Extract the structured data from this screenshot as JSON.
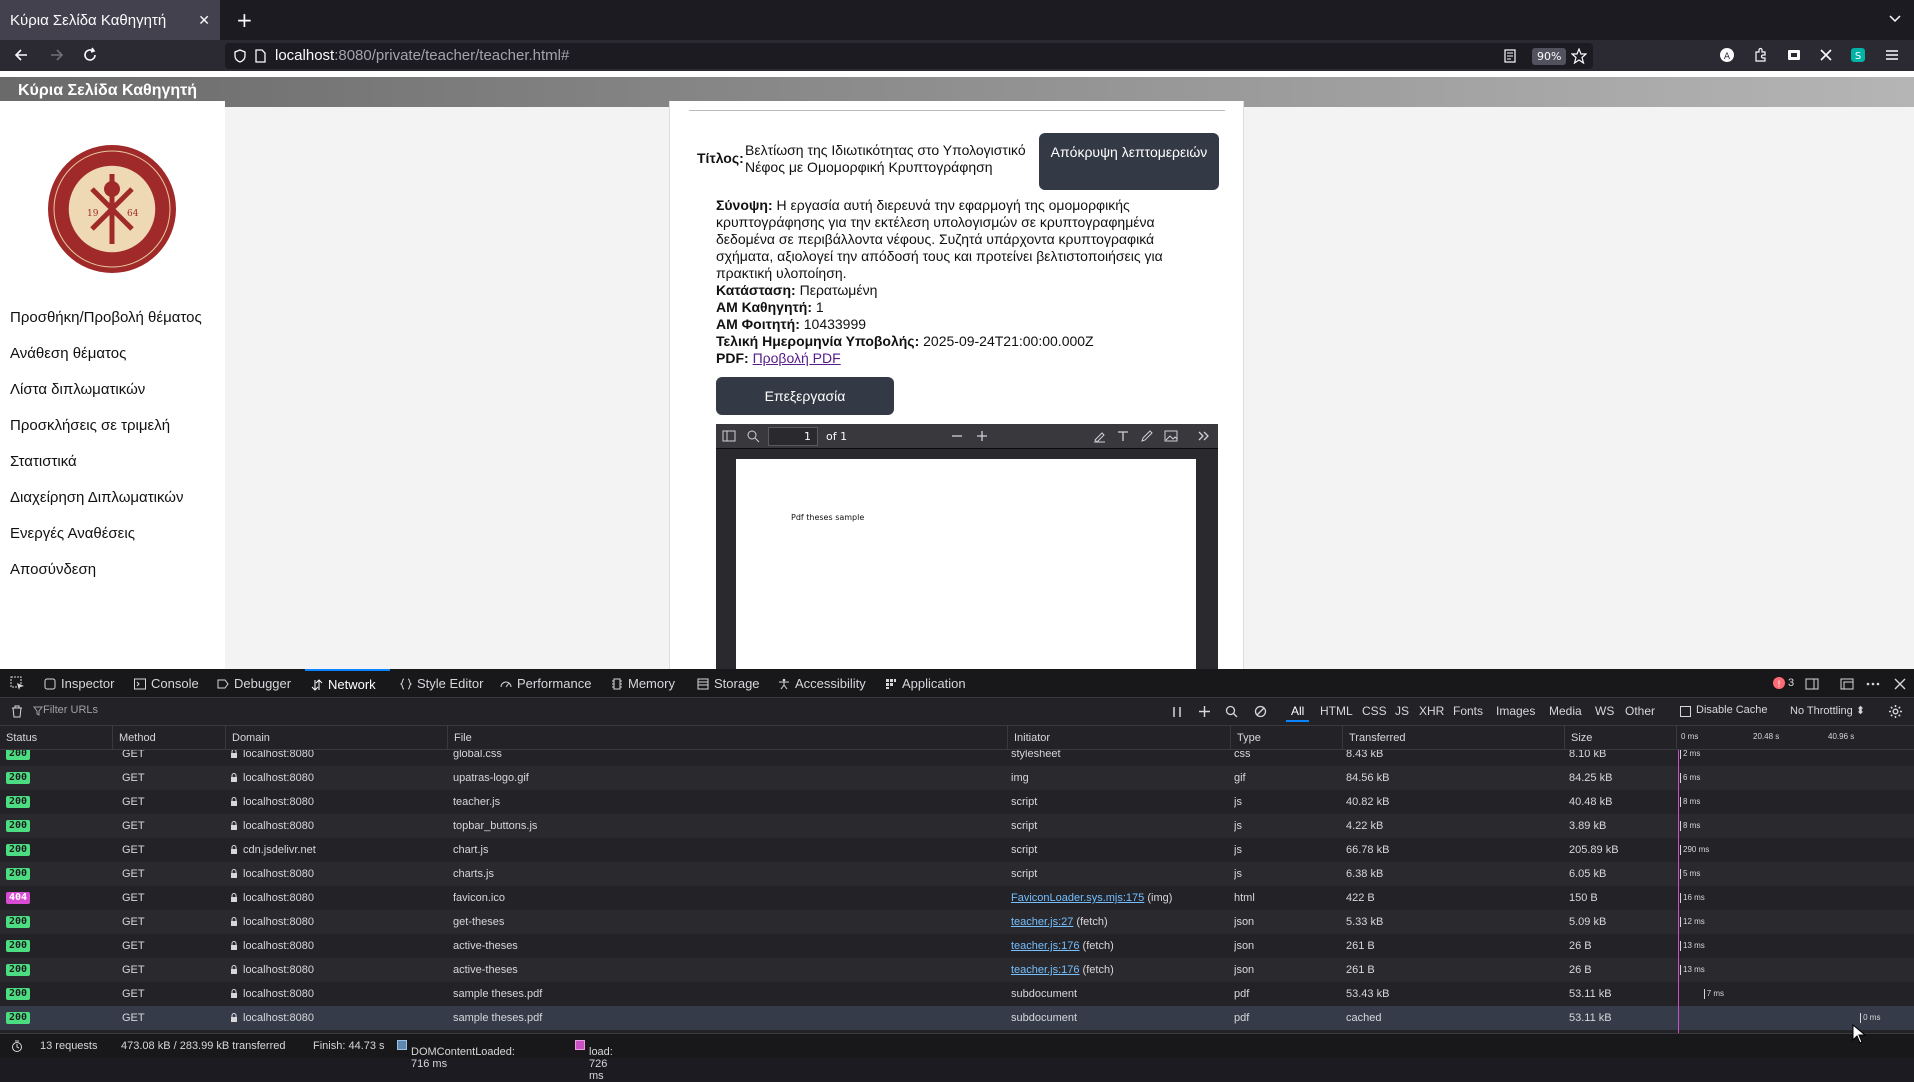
{
  "browser": {
    "tab_title": "Κύρια Σελίδα Καθηγητή",
    "url_host": "localhost",
    "url_rest": ":8080/private/teacher/teacher.html#",
    "zoom": "90%"
  },
  "page": {
    "header": "Κύρια Σελίδα Καθηγητή",
    "sidebar": [
      "Προσθήκη/Προβολή θέματος",
      "Ανάθεση θέματος",
      "Λίστα διπλωματικών",
      "Προσκλήσεις σε τριμελή",
      "Στατιστικά",
      "Διαχείρηση Διπλωματικών",
      "Ενεργές Αναθέσεις",
      "Αποσύνδεση"
    ],
    "logo": {
      "year_left": "19",
      "year_right": "64",
      "ring_text": "ΠΑΝΕΠΙΣΤΗΜΙΟ ΠΑΤΡΩΝ · UNIVERSITY OF PATRAS"
    },
    "thesis": {
      "title_label": "Τίτλος:",
      "title": "Βελτίωση της Ιδιωτικότητας στο Υπολογιστικό Νέφος με Ομομορφική Κρυπτογράφηση",
      "hide_button": "Απόκρυψη λεπτομερειών",
      "summary_label": "Σύνοψη:",
      "summary": "Η εργασία αυτή διερευνά την εφαρμογή της ομομορφικής κρυπτογράφησης για την εκτέλεση υπολογισμών σε κρυπτογραφημένα δεδομένα σε περιβάλλοντα νέφους. Συζητά υπάρχοντα κρυπτογραφικά σχήματα, αξιολογεί την απόδοσή τους και προτείνει βελτιστοποιήσεις για πρακτική υλοποίηση.",
      "status_label": "Κατάσταση:",
      "status": "Περατωμένη",
      "prof_label": "ΑΜ Καθηγητή:",
      "prof": "1",
      "student_label": "ΑΜ Φοιτητή:",
      "student": "10433999",
      "deadline_label": "Τελική Ημερομηνία Υποβολής:",
      "deadline": "2025-09-24T21:00:00.000Z",
      "pdf_label": "PDF:",
      "pdf_link": "Προβολή PDF",
      "edit_button": "Επεξεργασία"
    },
    "pdf": {
      "page": "1",
      "of": "of 1",
      "content": "Pdf theses sample"
    }
  },
  "devtools": {
    "tabs": [
      "Inspector",
      "Console",
      "Debugger",
      "Network",
      "Style Editor",
      "Performance",
      "Memory",
      "Storage",
      "Accessibility",
      "Application"
    ],
    "error_count": "3",
    "filter_placeholder": "Filter URLs",
    "type_filters": [
      "All",
      "HTML",
      "CSS",
      "JS",
      "XHR",
      "Fonts",
      "Images",
      "Media",
      "WS",
      "Other"
    ],
    "disable_cache": "Disable Cache",
    "throttling": "No Throttling ⬍",
    "columns": [
      "Status",
      "Method",
      "Domain",
      "File",
      "Initiator",
      "Type",
      "Transferred",
      "Size"
    ],
    "timeline_ticks": [
      "0 ms",
      "20.48 s",
      "40.96 s"
    ],
    "rows": [
      {
        "status": "200",
        "method": "GET",
        "domain": "localhost:8080",
        "file": "global.css",
        "initiator": "stylesheet",
        "initiator_link": "",
        "type": "css",
        "transferred": "8.43 kB",
        "size": "8.10 kB",
        "time": "2 ms",
        "wf_pos": 0.0
      },
      {
        "status": "200",
        "method": "GET",
        "domain": "localhost:8080",
        "file": "upatras-logo.gif",
        "initiator": "img",
        "initiator_link": "",
        "type": "gif",
        "transferred": "84.56 kB",
        "size": "84.25 kB",
        "time": "6 ms",
        "wf_pos": 0.0
      },
      {
        "status": "200",
        "method": "GET",
        "domain": "localhost:8080",
        "file": "teacher.js",
        "initiator": "script",
        "initiator_link": "",
        "type": "js",
        "transferred": "40.82 kB",
        "size": "40.48 kB",
        "time": "8 ms",
        "wf_pos": 0.0
      },
      {
        "status": "200",
        "method": "GET",
        "domain": "localhost:8080",
        "file": "topbar_buttons.js",
        "initiator": "script",
        "initiator_link": "",
        "type": "js",
        "transferred": "4.22 kB",
        "size": "3.89 kB",
        "time": "8 ms",
        "wf_pos": 0.0
      },
      {
        "status": "200",
        "method": "GET",
        "domain": "cdn.jsdelivr.net",
        "file": "chart.js",
        "initiator": "script",
        "initiator_link": "",
        "type": "js",
        "transferred": "66.78 kB",
        "size": "205.89 kB",
        "time": "290 ms",
        "wf_pos": 0.0
      },
      {
        "status": "200",
        "method": "GET",
        "domain": "localhost:8080",
        "file": "charts.js",
        "initiator": "script",
        "initiator_link": "",
        "type": "js",
        "transferred": "6.38 kB",
        "size": "6.05 kB",
        "time": "5 ms",
        "wf_pos": 0.0
      },
      {
        "status": "404",
        "method": "GET",
        "domain": "localhost:8080",
        "file": "favicon.ico",
        "initiator": " (img)",
        "initiator_link": "FaviconLoader.sys.mjs:175",
        "type": "html",
        "transferred": "422 B",
        "size": "150 B",
        "time": "16 ms",
        "wf_pos": 0.0
      },
      {
        "status": "200",
        "method": "GET",
        "domain": "localhost:8080",
        "file": "get-theses",
        "initiator": " (fetch)",
        "initiator_link": "teacher.js:27",
        "type": "json",
        "transferred": "5.33 kB",
        "size": "5.09 kB",
        "time": "12 ms",
        "wf_pos": 0.0
      },
      {
        "status": "200",
        "method": "GET",
        "domain": "localhost:8080",
        "file": "active-theses",
        "initiator": " (fetch)",
        "initiator_link": "teacher.js:176",
        "type": "json",
        "transferred": "261 B",
        "size": "26 B",
        "time": "13 ms",
        "wf_pos": 0.0
      },
      {
        "status": "200",
        "method": "GET",
        "domain": "localhost:8080",
        "file": "active-theses",
        "initiator": " (fetch)",
        "initiator_link": "teacher.js:176",
        "type": "json",
        "transferred": "261 B",
        "size": "26 B",
        "time": "13 ms",
        "wf_pos": 0.0
      },
      {
        "status": "200",
        "method": "GET",
        "domain": "localhost:8080",
        "file": "sample theses.pdf",
        "initiator": "subdocument",
        "initiator_link": "",
        "type": "pdf",
        "transferred": "53.43 kB",
        "size": "53.11 kB",
        "time": "7 ms",
        "wf_pos": 0.1
      },
      {
        "status": "200",
        "method": "GET",
        "domain": "localhost:8080",
        "file": "sample theses.pdf",
        "initiator": "subdocument",
        "initiator_link": "",
        "type": "pdf",
        "transferred": "cached",
        "size": "53.11 kB",
        "time": "0 ms",
        "wf_pos": 0.76
      }
    ],
    "summary": {
      "requests": "13 requests",
      "transferred": "473.08 kB / 283.99 kB transferred",
      "finish": "Finish: 44.73 s",
      "dcl": "DOMContentLoaded: 716 ms",
      "load": "load: 726 ms"
    },
    "colors": {
      "status_ok": "#4ade80",
      "status_404": "#d74cd2",
      "accent": "#0a84ff",
      "dcl": "#5e88b0",
      "load": "#c951c3"
    }
  }
}
